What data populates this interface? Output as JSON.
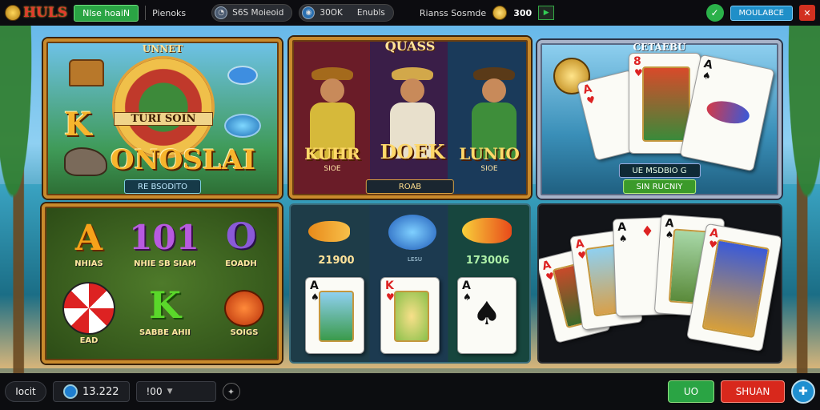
{
  "topbar": {
    "logo": "HULS",
    "home_button": "Nlse hoaiN",
    "menu_label": "Pienoks",
    "pill1": "S6S Moieoid",
    "pill2_a": "30OK",
    "pill2_b": "Enubls",
    "links": "Rianss Sosmde",
    "coins": "300",
    "action_button": "MOULABCE"
  },
  "panel1": {
    "banner": "UNNET",
    "wheel_text": "TURI SOIN",
    "title_k": "K",
    "title": "ONOSLAI",
    "plate": "RE BSODITO"
  },
  "panel2": {
    "banner": "QUASS",
    "col1_title": "KUHR",
    "col1_sub": "SIOE",
    "col2_title": "DOEK",
    "col3_title": "LUNIO",
    "col3_sub": "SIOE",
    "plate": "ROAB"
  },
  "panel3": {
    "banner": "CETAEBU",
    "plate1": "UE MSDBIO G",
    "plate2": "SIN RUCNIY"
  },
  "panel4": {
    "sym_a": "A",
    "label_a": "NHIAS",
    "sym_b": "101",
    "label_b": "NHIE SB SIAM",
    "sym_c": "O",
    "label_c": "EOADH",
    "label_wheel": "EAD",
    "sym_k": "K",
    "label_k": "SABBE AHII",
    "label_horn": "SOIGS"
  },
  "panel5": {
    "value1": "21900",
    "value2": "LESU",
    "value3": "173006"
  },
  "bottombar": {
    "left_label": "Iocit",
    "balance": "13.222",
    "bet": "!00",
    "bet_caret": "▼",
    "green_button": "UO",
    "red_button": "SHUAN"
  }
}
